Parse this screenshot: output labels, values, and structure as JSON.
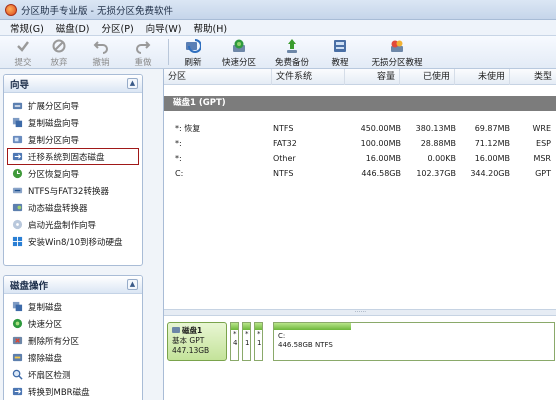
{
  "window": {
    "title": "分区助手专业版 - 无损分区免费软件"
  },
  "menu": [
    "常规(G)",
    "磁盘(D)",
    "分区(P)",
    "向导(W)",
    "帮助(H)"
  ],
  "toolbar": [
    {
      "label": "提交",
      "icon": "check-icon",
      "disabled": true
    },
    {
      "label": "放弃",
      "icon": "discard-icon",
      "disabled": true
    },
    {
      "label": "撤销",
      "icon": "undo-icon",
      "disabled": true
    },
    {
      "label": "重做",
      "icon": "redo-icon",
      "disabled": true
    },
    {
      "label": "刷新",
      "icon": "refresh-icon",
      "disabled": false
    },
    {
      "label": "快速分区",
      "icon": "quick-partition-icon",
      "disabled": false
    },
    {
      "label": "免费备份",
      "icon": "backup-icon",
      "disabled": false
    },
    {
      "label": "教程",
      "icon": "tutorial-icon",
      "disabled": false
    },
    {
      "label": "无损分区教程",
      "icon": "lossless-tutorial-icon",
      "disabled": false
    }
  ],
  "wizard_group": {
    "title": "向导",
    "items": [
      "扩展分区向导",
      "复制磁盘向导",
      "复制分区向导",
      "迁移系统到固态磁盘",
      "分区恢复向导",
      "NTFS与FAT32转换器",
      "动态磁盘转换器",
      "启动光盘制作向导",
      "安装Win8/10到移动硬盘"
    ]
  },
  "disk_ops_group": {
    "title": "磁盘操作",
    "items": [
      "复制磁盘",
      "快速分区",
      "删除所有分区",
      "擦除磁盘",
      "坏扇区检测",
      "转换到MBR磁盘"
    ]
  },
  "table": {
    "columns": [
      "分区",
      "文件系统",
      "容量",
      "已使用",
      "未使用",
      "类型"
    ],
    "disk_label": "磁盘1 (GPT)",
    "rows": [
      {
        "partition": "*: 恢复",
        "fs": "NTFS",
        "capacity": "450.00MB",
        "used": "380.13MB",
        "free": "69.87MB",
        "type": "WRE"
      },
      {
        "partition": "*:",
        "fs": "FAT32",
        "capacity": "100.00MB",
        "used": "28.88MB",
        "free": "71.12MB",
        "type": "ESP"
      },
      {
        "partition": "*:",
        "fs": "Other",
        "capacity": "16.00MB",
        "used": "0.00KB",
        "free": "16.00MB",
        "type": "MSR"
      },
      {
        "partition": "C:",
        "fs": "NTFS",
        "capacity": "446.58GB",
        "used": "102.37GB",
        "free": "344.20GB",
        "type": "GPT"
      }
    ]
  },
  "diskmap": {
    "name": "磁盘1",
    "kind": "基本 GPT",
    "size": "447.13GB",
    "small_labels": [
      "*",
      "*",
      "*"
    ],
    "small_texts": [
      "4",
      "1",
      "1"
    ],
    "main_label": "C:",
    "main_text": "446.58GB NTFS"
  }
}
